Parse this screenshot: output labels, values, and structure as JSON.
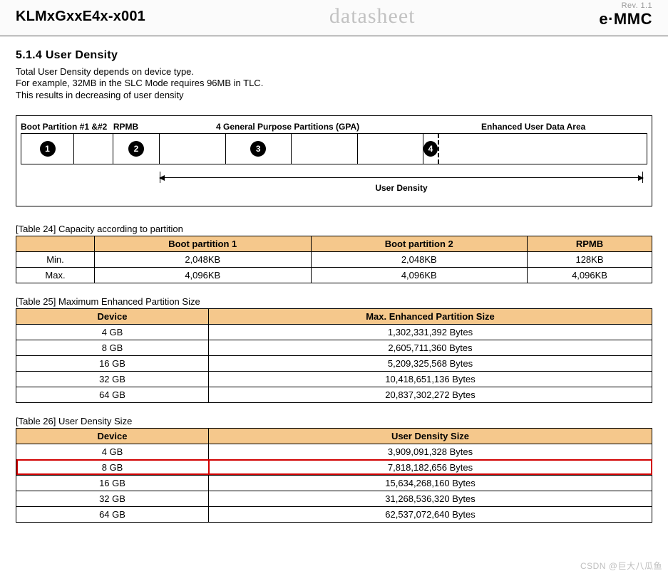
{
  "header": {
    "part_number": "KLMxGxxE4x-x001",
    "center": "datasheet",
    "rev": "Rev. 1.1",
    "logo": "e·MMC"
  },
  "section": {
    "number_title": "5.1.4 User Density",
    "line1": "Total User Density depends on device type.",
    "line2": "For example, 32MB in the SLC Mode requires 96MB in TLC.",
    "line3": "This results in decreasing of user density"
  },
  "diagram": {
    "labels": {
      "boot": "Boot Partition #1 &#2",
      "rpmb": "RPMB",
      "gpa": "4 General Purpose Partitions (GPA)",
      "eud": "Enhanced User Data Area"
    },
    "circle1": "1",
    "circle2": "2",
    "circle3": "3",
    "circle4": "4",
    "density_label": "User Density"
  },
  "table24": {
    "caption": "[Table 24] Capacity according to partition",
    "headers": [
      "",
      "Boot partition 1",
      "Boot partition 2",
      "RPMB"
    ],
    "rows": [
      [
        "Min.",
        "2,048KB",
        "2,048KB",
        "128KB"
      ],
      [
        "Max.",
        "4,096KB",
        "4,096KB",
        "4,096KB"
      ]
    ]
  },
  "table25": {
    "caption": "[Table 25] Maximum Enhanced Partition Size",
    "headers": [
      "Device",
      "Max. Enhanced Partition Size"
    ],
    "rows": [
      [
        "4 GB",
        "1,302,331,392 Bytes"
      ],
      [
        "8 GB",
        "2,605,711,360 Bytes"
      ],
      [
        "16 GB",
        "5,209,325,568 Bytes"
      ],
      [
        "32 GB",
        "10,418,651,136 Bytes"
      ],
      [
        "64 GB",
        "20,837,302,272 Bytes"
      ]
    ]
  },
  "table26": {
    "caption": "[Table 26] User Density Size",
    "headers": [
      "Device",
      "User Density Size"
    ],
    "rows": [
      [
        "4 GB",
        "3,909,091,328 Bytes"
      ],
      [
        "8 GB",
        "7,818,182,656 Bytes"
      ],
      [
        "16 GB",
        "15,634,268,160 Bytes"
      ],
      [
        "32 GB",
        "31,268,536,320 Bytes"
      ],
      [
        "64 GB",
        "62,537,072,640 Bytes"
      ]
    ],
    "highlight_index": 1
  },
  "watermark": "CSDN @巨大八瓜鱼"
}
